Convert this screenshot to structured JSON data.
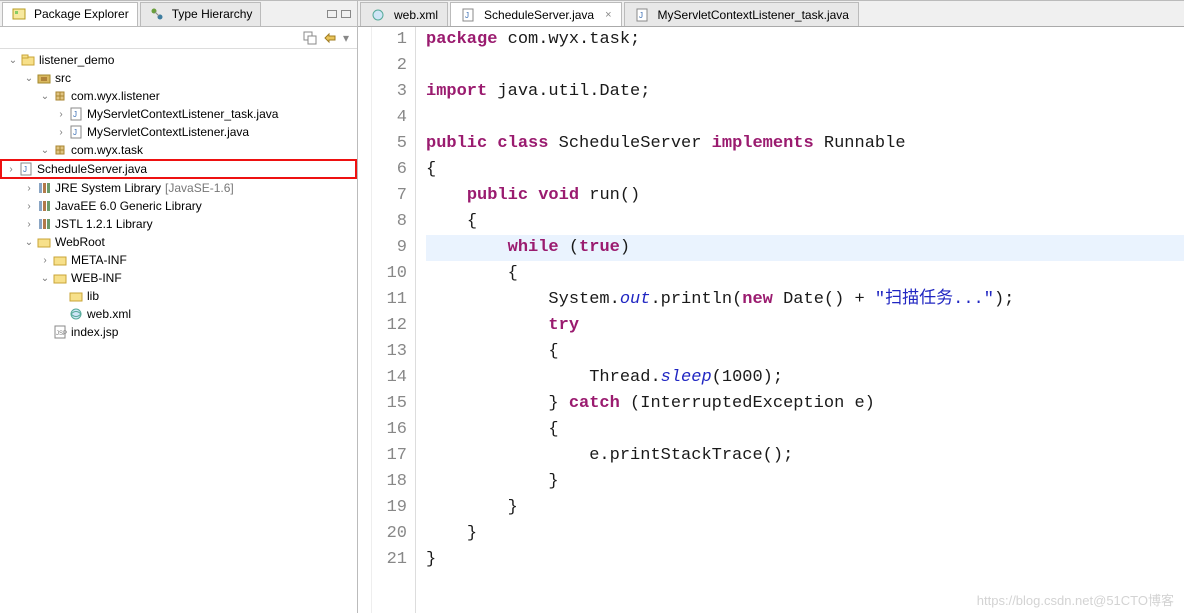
{
  "leftTabs": {
    "tab1": "Package Explorer",
    "tab2": "Type Hierarchy"
  },
  "tree": {
    "project": "listener_demo",
    "src": "src",
    "pkg_listener": "com.wyx.listener",
    "file_task_listener": "MyServletContextListener_task.java",
    "file_ctx_listener": "MyServletContextListener.java",
    "pkg_task": "com.wyx.task",
    "file_schedule": "ScheduleServer.java",
    "lib_jre": "JRE System Library",
    "lib_jre_suffix": "[JavaSE-1.6]",
    "lib_javaee": "JavaEE 6.0 Generic Library",
    "lib_jstl": "JSTL 1.2.1 Library",
    "webroot": "WebRoot",
    "metainf": "META-INF",
    "webinf": "WEB-INF",
    "lib_folder": "lib",
    "webxml": "web.xml",
    "indexjsp": "index.jsp"
  },
  "editorTabs": {
    "t1": "web.xml",
    "t2": "ScheduleServer.java",
    "t3": "MyServletContextListener_task.java"
  },
  "code": {
    "l1_kw": "package",
    "l1_rest": " com.wyx.task;",
    "l3_kw": "import",
    "l3_rest": " java.util.Date;",
    "l5_kw1": "public",
    "l5_kw2": "class",
    "l5_name": " ScheduleServer ",
    "l5_kw3": "implements",
    "l5_rest": " Runnable",
    "l6": "{",
    "l7_kw1": "public",
    "l7_kw2": "void",
    "l7_rest": " run()",
    "l8": "{",
    "l9_kw": "while",
    "l9_rest1": " (",
    "l9_kw2": "true",
    "l9_rest2": ")",
    "l10": "{",
    "l11_a": "System.",
    "l11_out": "out",
    "l11_b": ".println(",
    "l11_kw": "new",
    "l11_c": " Date() + ",
    "l11_str": "\"扫描任务...\"",
    "l11_d": ");",
    "l12_kw": "try",
    "l13": "{",
    "l14_a": "Thread.",
    "l14_sleep": "sleep",
    "l14_b": "(1000);",
    "l15_a": "} ",
    "l15_kw": "catch",
    "l15_b": " (InterruptedException e)",
    "l16": "{",
    "l17": "e.printStackTrace();",
    "l18": "}",
    "l19": "}",
    "l20": "}",
    "l21": "}"
  },
  "lineNumbers": [
    "1",
    "2",
    "3",
    "4",
    "5",
    "6",
    "7",
    "8",
    "9",
    "10",
    "11",
    "12",
    "13",
    "14",
    "15",
    "16",
    "17",
    "18",
    "19",
    "20",
    "21"
  ],
  "watermark": "https://blog.csdn.net@51CTO博客"
}
